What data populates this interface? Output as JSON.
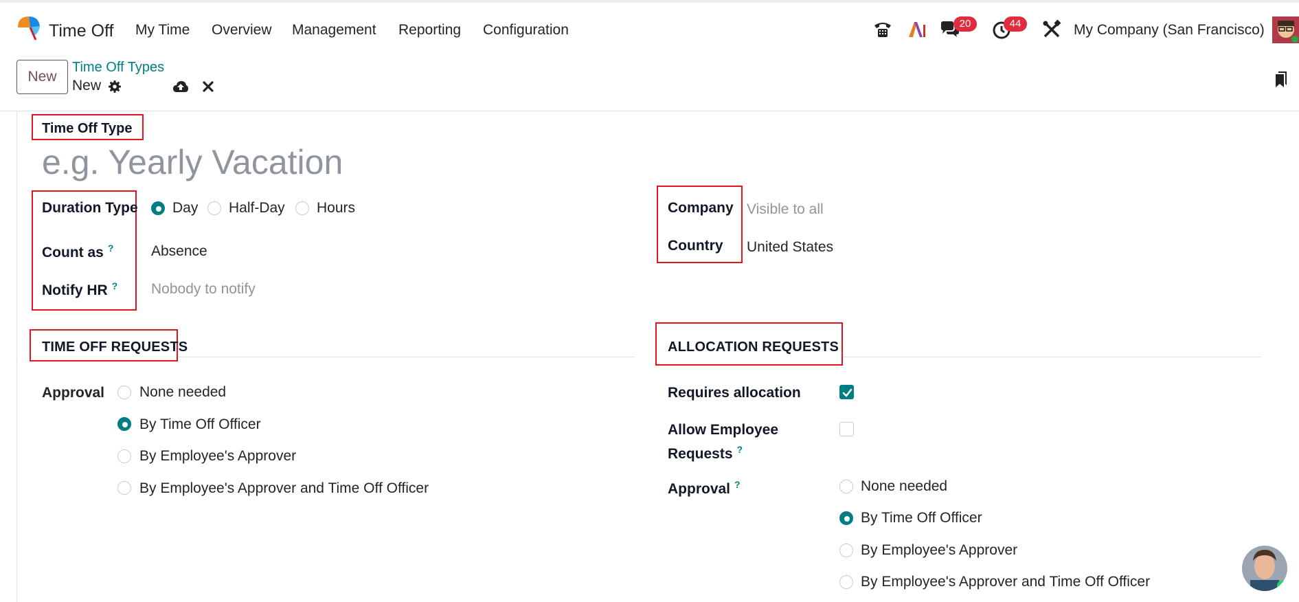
{
  "app": {
    "name": "Time Off"
  },
  "menu": [
    "My Time",
    "Overview",
    "Management",
    "Reporting",
    "Configuration"
  ],
  "systray": {
    "messages_count": "20",
    "activities_count": "44",
    "company": "My Company (San Francisco)"
  },
  "control": {
    "new_label": "New",
    "breadcrumb_parent": "Time Off Types",
    "breadcrumb_current": "New"
  },
  "form": {
    "title_label": "Time Off Type",
    "title_placeholder": "e.g. Yearly Vacation",
    "duration_type": {
      "label": "Duration Type",
      "options": [
        "Day",
        "Half-Day",
        "Hours"
      ],
      "selected": "Day"
    },
    "count_as": {
      "label": "Count as",
      "help": "?",
      "value": "Absence"
    },
    "notify_hr": {
      "label": "Notify HR",
      "help": "?",
      "placeholder": "Nobody to notify"
    },
    "company": {
      "label": "Company",
      "placeholder": "Visible to all"
    },
    "country": {
      "label": "Country",
      "value": "United States"
    }
  },
  "time_off_requests": {
    "title": "TIME OFF REQUESTS",
    "approval_label": "Approval",
    "options": [
      "None needed",
      "By Time Off Officer",
      "By Employee's Approver",
      "By Employee's Approver and Time Off Officer"
    ],
    "selected": "By Time Off Officer"
  },
  "allocation_requests": {
    "title": "ALLOCATION REQUESTS",
    "requires_allocation": {
      "label": "Requires allocation",
      "checked": true
    },
    "allow_employee_requests": {
      "label_line1": "Allow Employee",
      "label_line2": "Requests",
      "help": "?",
      "checked": false
    },
    "approval_label": "Approval",
    "approval_help": "?",
    "options": [
      "None needed",
      "By Time Off Officer",
      "By Employee's Approver",
      "By Employee's Approver and Time Off Officer"
    ],
    "selected": "By Time Off Officer"
  },
  "colors": {
    "accent": "#017e84",
    "brand": "#714b67",
    "highlight_box": "#e3141e",
    "badge": "#e02c3c"
  }
}
